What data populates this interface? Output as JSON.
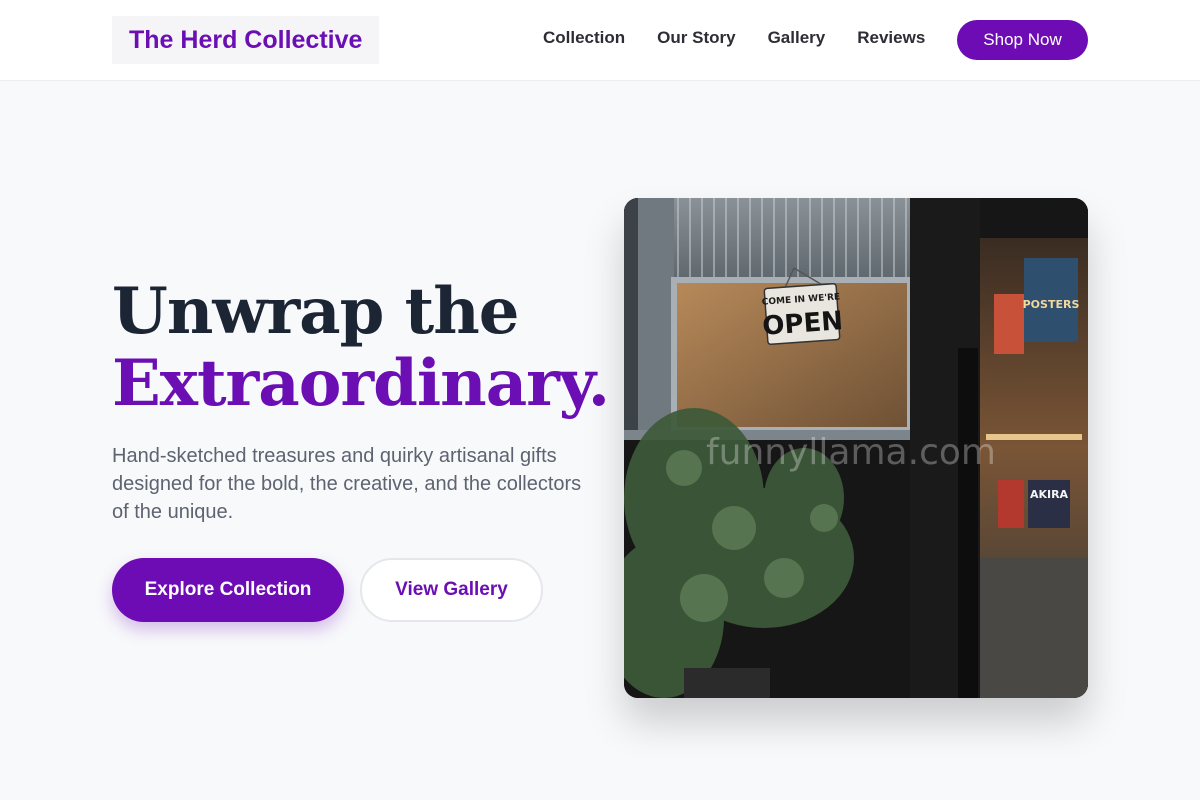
{
  "header": {
    "brand": "The Herd Collective",
    "nav": [
      "Collection",
      "Our Story",
      "Gallery",
      "Reviews"
    ],
    "cta": "Shop Now"
  },
  "hero": {
    "headline_line1": "Unwrap the",
    "headline_line2": "Extraordinary.",
    "subtext": "Hand-sketched treasures and quirky artisanal gifts designed for the bold, the creative, and the collectors of the unique.",
    "primary_button": "Explore Collection",
    "secondary_button": "View Gallery",
    "image": {
      "sign_line1": "COME IN WE'RE",
      "sign_line2": "OPEN",
      "poster_text": "POSTERS",
      "book_text": "AKIRA"
    },
    "watermark": "funnyllama.com"
  },
  "colors": {
    "accent": "#6d0bb5",
    "headline_dark": "#1c2533",
    "background": "#f8f9fb"
  }
}
